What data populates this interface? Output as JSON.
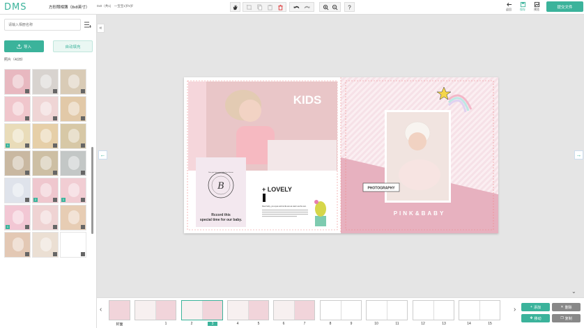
{
  "header": {
    "logo": "DMS",
    "product_title": "方形照相簿（8x8英寸）",
    "product_meta": "0x0（共1)　一宝宝1岁5岁",
    "tools": [
      "hand-icon",
      "crop-icon",
      "copy-icon",
      "paste-icon",
      "delete-icon",
      "undo-icon",
      "redo-icon",
      "zoom-in-icon",
      "zoom-out-icon",
      "help-icon"
    ],
    "back_label": "返回",
    "save_label": "保存",
    "preview_label": "预览",
    "submit_label": "提交文件"
  },
  "sidebar": {
    "search_placeholder": "请输入相册名称",
    "import_label": "导入",
    "autofill_label": "自动填充",
    "photo_count": "照片（4/28）",
    "photos": [
      {
        "color": "#e8b8c0",
        "badge": ""
      },
      {
        "color": "#d8d3cf",
        "badge": ""
      },
      {
        "color": "#d9cbb6",
        "badge": ""
      },
      {
        "color": "#f0c6cc",
        "badge": ""
      },
      {
        "color": "#efd5d5",
        "badge": ""
      },
      {
        "color": "#e2c9a8",
        "badge": ""
      },
      {
        "color": "#e9dcb9",
        "badge": "1"
      },
      {
        "color": "#e6cfa8",
        "badge": ""
      },
      {
        "color": "#d7c8a6",
        "badge": ""
      },
      {
        "color": "#c9b8a1",
        "badge": ""
      },
      {
        "color": "#cdbfa4",
        "badge": ""
      },
      {
        "color": "#c3c7c6",
        "badge": ""
      },
      {
        "color": "#dfe3eb",
        "badge": ""
      },
      {
        "color": "#efc7ce",
        "badge": "2"
      },
      {
        "color": "#f1cdd3",
        "badge": "1"
      },
      {
        "color": "#f2c7d4",
        "badge": "1"
      },
      {
        "color": "#efd3d3",
        "badge": ""
      },
      {
        "color": "#e7cdb4",
        "badge": ""
      },
      {
        "color": "#e3c8b4",
        "badge": ""
      },
      {
        "color": "#ebdfd3",
        "badge": ""
      },
      {
        "color": "#ffffff",
        "badge": ""
      }
    ]
  },
  "canvas": {
    "kids_title": "KIDS",
    "lovely_label": "+ LOVELY",
    "record_text_1": "Rccord this",
    "record_text_2": "special time for our baby.",
    "body_line": "Dear baby, you eyes and smile are as warm as the sun.",
    "photography_label": "PHOTOGRAPHY",
    "pink_baby_label": "PINK&BABY",
    "monogram_letter": "B",
    "monogram_ring": "See you keep your baby face forever"
  },
  "pagebar": {
    "pages": [
      {
        "labels": [
          "封面"
        ],
        "active": false
      },
      {
        "labels": [
          "1"
        ],
        "active": false
      },
      {
        "labels": [
          "2",
          "3"
        ],
        "active": true
      },
      {
        "labels": [
          "4",
          "5"
        ],
        "active": false
      },
      {
        "labels": [
          "6",
          "7"
        ],
        "active": false
      },
      {
        "labels": [
          "8",
          "9"
        ],
        "active": false
      },
      {
        "labels": [
          "10",
          "11"
        ],
        "active": false
      },
      {
        "labels": [
          "12",
          "13"
        ],
        "active": false
      },
      {
        "labels": [
          "14",
          "15"
        ],
        "active": false
      }
    ],
    "add_label": "添加",
    "delete_label": "删除",
    "move_label": "移动",
    "copy_label": "复制"
  },
  "colors": {
    "accent": "#3bb39b",
    "pink": "#e7b1bf"
  }
}
